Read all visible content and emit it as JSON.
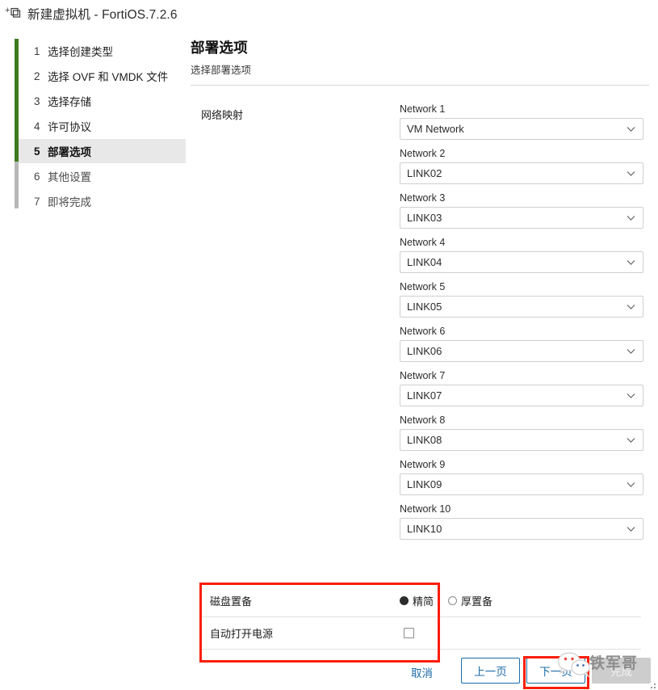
{
  "window": {
    "title": "新建虚拟机 - FortiOS.7.2.6",
    "icon": "new-virtual-machine-icon"
  },
  "sidebar": {
    "steps": [
      {
        "num": "1",
        "label": "选择创建类型",
        "state": "done"
      },
      {
        "num": "2",
        "label": "选择 OVF 和 VMDK 文件",
        "state": "done"
      },
      {
        "num": "3",
        "label": "选择存储",
        "state": "done"
      },
      {
        "num": "4",
        "label": "许可协议",
        "state": "done"
      },
      {
        "num": "5",
        "label": "部署选项",
        "state": "active"
      },
      {
        "num": "6",
        "label": "其他设置",
        "state": "future"
      },
      {
        "num": "7",
        "label": "即将完成",
        "state": "future"
      }
    ]
  },
  "page": {
    "title": "部署选项",
    "subtitle": "选择部署选项"
  },
  "network_mapping": {
    "label": "网络映射",
    "items": [
      {
        "name": "Network 1",
        "value": "VM Network"
      },
      {
        "name": "Network 2",
        "value": "LINK02"
      },
      {
        "name": "Network 3",
        "value": "LINK03"
      },
      {
        "name": "Network 4",
        "value": "LINK04"
      },
      {
        "name": "Network 5",
        "value": "LINK05"
      },
      {
        "name": "Network 6",
        "value": "LINK06"
      },
      {
        "name": "Network 7",
        "value": "LINK07"
      },
      {
        "name": "Network 8",
        "value": "LINK08"
      },
      {
        "name": "Network 9",
        "value": "LINK09"
      },
      {
        "name": "Network 10",
        "value": "LINK10"
      }
    ]
  },
  "options": {
    "disk_provisioning": {
      "label": "磁盘置备",
      "choices": [
        {
          "label": "精简",
          "selected": true
        },
        {
          "label": "厚置备",
          "selected": false
        }
      ]
    },
    "power_on": {
      "label": "自动打开电源",
      "checked": false
    }
  },
  "footer": {
    "cancel": "取消",
    "previous": "上一页",
    "next": "下一页",
    "finish": "完成"
  },
  "watermark": {
    "text": "铁军哥",
    "logo": "wechat-icon"
  },
  "colors": {
    "accent_blue": "#1c6ca9",
    "progress_green": "#3f7b1f",
    "highlight_red": "#fa1e09",
    "active_step_bg": "#e8e8e8"
  }
}
